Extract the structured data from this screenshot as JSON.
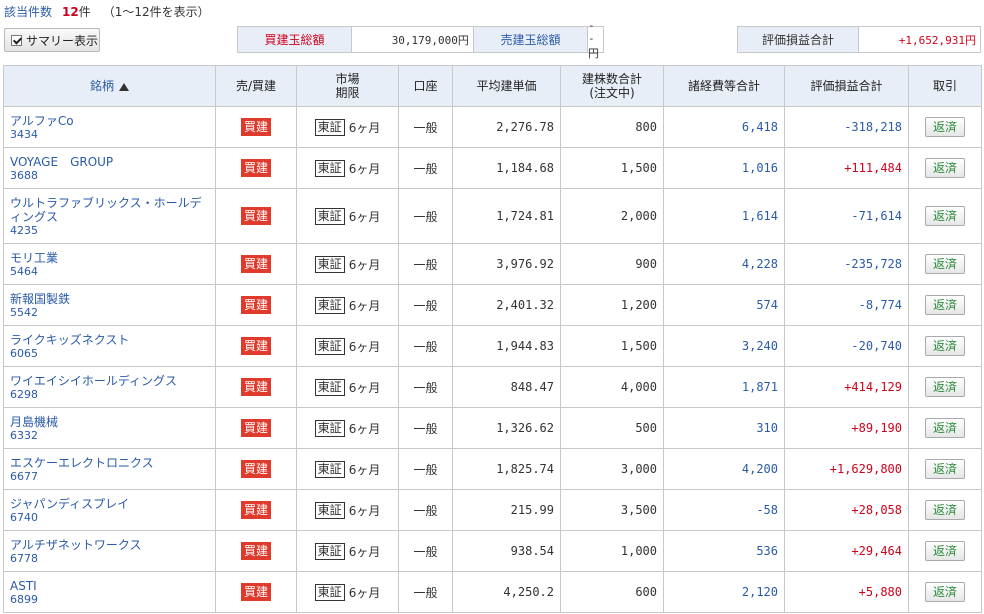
{
  "header": {
    "count_label": "該当件数",
    "count": "12",
    "count_unit": "件",
    "range": "（1〜12件を表示）"
  },
  "summary_toggle": {
    "label": "サマリー表示",
    "checked": true
  },
  "totals": {
    "buy_label": "買建玉総額",
    "buy_value": "30,179,000円",
    "sell_label": "売建玉総額",
    "sell_value": "--円",
    "pl_label": "評価損益合計",
    "pl_value": "+1,652,931円"
  },
  "columns": {
    "name": "銘柄",
    "side": "売/買建",
    "market_line1": "市場",
    "market_line2": "期限",
    "account": "口座",
    "avg_price": "平均建単価",
    "qty_line1": "建株数合計",
    "qty_line2": "(注文中)",
    "fees": "諸経費等合計",
    "pl": "評価損益合計",
    "trade": "取引"
  },
  "rows": [
    {
      "name": "アルファCo",
      "code": "3434",
      "side": "買建",
      "market": "東証",
      "term": "6ヶ月",
      "account": "一般",
      "avg": "2,276.78",
      "qty": "800",
      "fees": "6,418",
      "pl": "-318,218",
      "pl_sign": "neg",
      "action": "返済"
    },
    {
      "name": "VOYAGE　GROUP",
      "code": "3688",
      "side": "買建",
      "market": "東証",
      "term": "6ヶ月",
      "account": "一般",
      "avg": "1,184.68",
      "qty": "1,500",
      "fees": "1,016",
      "pl": "+111,484",
      "pl_sign": "pos",
      "action": "返済"
    },
    {
      "name": "ウルトラファブリックス・ホールディングス",
      "code": "4235",
      "side": "買建",
      "market": "東証",
      "term": "6ヶ月",
      "account": "一般",
      "avg": "1,724.81",
      "qty": "2,000",
      "fees": "1,614",
      "pl": "-71,614",
      "pl_sign": "neg",
      "action": "返済"
    },
    {
      "name": "モリ工業",
      "code": "5464",
      "side": "買建",
      "market": "東証",
      "term": "6ヶ月",
      "account": "一般",
      "avg": "3,976.92",
      "qty": "900",
      "fees": "4,228",
      "pl": "-235,728",
      "pl_sign": "neg",
      "action": "返済"
    },
    {
      "name": "新報国製鉄",
      "code": "5542",
      "side": "買建",
      "market": "東証",
      "term": "6ヶ月",
      "account": "一般",
      "avg": "2,401.32",
      "qty": "1,200",
      "fees": "574",
      "pl": "-8,774",
      "pl_sign": "neg",
      "action": "返済"
    },
    {
      "name": "ライクキッズネクスト",
      "code": "6065",
      "side": "買建",
      "market": "東証",
      "term": "6ヶ月",
      "account": "一般",
      "avg": "1,944.83",
      "qty": "1,500",
      "fees": "3,240",
      "pl": "-20,740",
      "pl_sign": "neg",
      "action": "返済"
    },
    {
      "name": "ワイエイシイホールディングス",
      "code": "6298",
      "side": "買建",
      "market": "東証",
      "term": "6ヶ月",
      "account": "一般",
      "avg": "848.47",
      "qty": "4,000",
      "fees": "1,871",
      "pl": "+414,129",
      "pl_sign": "pos",
      "action": "返済"
    },
    {
      "name": "月島機械",
      "code": "6332",
      "side": "買建",
      "market": "東証",
      "term": "6ヶ月",
      "account": "一般",
      "avg": "1,326.62",
      "qty": "500",
      "fees": "310",
      "pl": "+89,190",
      "pl_sign": "pos",
      "action": "返済"
    },
    {
      "name": "エスケーエレクトロニクス",
      "code": "6677",
      "side": "買建",
      "market": "東証",
      "term": "6ヶ月",
      "account": "一般",
      "avg": "1,825.74",
      "qty": "3,000",
      "fees": "4,200",
      "pl": "+1,629,800",
      "pl_sign": "pos",
      "action": "返済"
    },
    {
      "name": "ジャパンディスプレイ",
      "code": "6740",
      "side": "買建",
      "market": "東証",
      "term": "6ヶ月",
      "account": "一般",
      "avg": "215.99",
      "qty": "3,500",
      "fees": "-58",
      "pl": "+28,058",
      "pl_sign": "pos",
      "action": "返済"
    },
    {
      "name": "アルチザネットワークス",
      "code": "6778",
      "side": "買建",
      "market": "東証",
      "term": "6ヶ月",
      "account": "一般",
      "avg": "938.54",
      "qty": "1,000",
      "fees": "536",
      "pl": "+29,464",
      "pl_sign": "pos",
      "action": "返済"
    },
    {
      "name": "ASTI",
      "code": "6899",
      "side": "買建",
      "market": "東証",
      "term": "6ヶ月",
      "account": "一般",
      "avg": "4,250.2",
      "qty": "600",
      "fees": "2,120",
      "pl": "+5,880",
      "pl_sign": "pos",
      "action": "返済"
    }
  ],
  "colors": {
    "link": "#2a5aa8",
    "positive": "#d0021b",
    "badge": "#e03a2c",
    "header_bg": "#e8eef7"
  }
}
